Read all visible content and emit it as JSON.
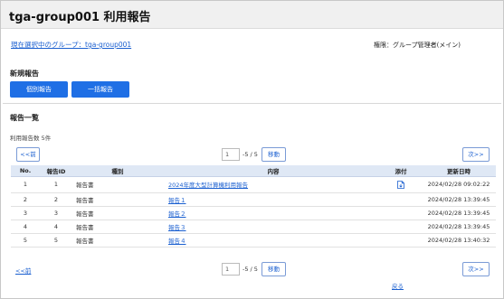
{
  "header": {
    "title": "tga-group001 利用報告"
  },
  "group": {
    "current_label": "現在選択中のグループ：tga-group001"
  },
  "role": {
    "text": "権限：グループ管理者(メイン)"
  },
  "new_report": {
    "heading": "新規報告",
    "individual_label": "個別報告",
    "bulk_label": "一括報告"
  },
  "report_list": {
    "heading": "報告一覧",
    "count_text": "利用報告数 5件",
    "pager_top": {
      "prev": "<<前",
      "page": "1",
      "total": "-5 / 5",
      "go": "移動",
      "next": "次>>"
    },
    "pager_bottom": {
      "prev": "<<前",
      "page": "1",
      "total": "-5 / 5",
      "go": "移動",
      "next": "次>>"
    },
    "columns": [
      "No.",
      "報告ID",
      "種別",
      "内容",
      "添付",
      "更新日時"
    ],
    "rows": [
      {
        "no": "1",
        "id": "1",
        "type": "報告書",
        "content": "2024年度大型計算機利用報告",
        "attachment": "file-icon",
        "updated": "2024/02/28 09:02:22"
      },
      {
        "no": "2",
        "id": "2",
        "type": "報告書",
        "content": "報告１",
        "attachment": "",
        "updated": "2024/02/28 13:39:45"
      },
      {
        "no": "3",
        "id": "3",
        "type": "報告書",
        "content": "報告２",
        "attachment": "",
        "updated": "2024/02/28 13:39:45"
      },
      {
        "no": "4",
        "id": "4",
        "type": "報告書",
        "content": "報告３",
        "attachment": "",
        "updated": "2024/02/28 13:39:45"
      },
      {
        "no": "5",
        "id": "5",
        "type": "報告書",
        "content": "報告４",
        "attachment": "",
        "updated": "2024/02/28 13:40:32"
      }
    ]
  },
  "footer": {
    "back_label": "戻る"
  },
  "colors": {
    "primary": "#1f6fe5",
    "link": "#1a5fd0",
    "header_row": "#dfe8f5",
    "title_bar": "#f0f0f0"
  }
}
